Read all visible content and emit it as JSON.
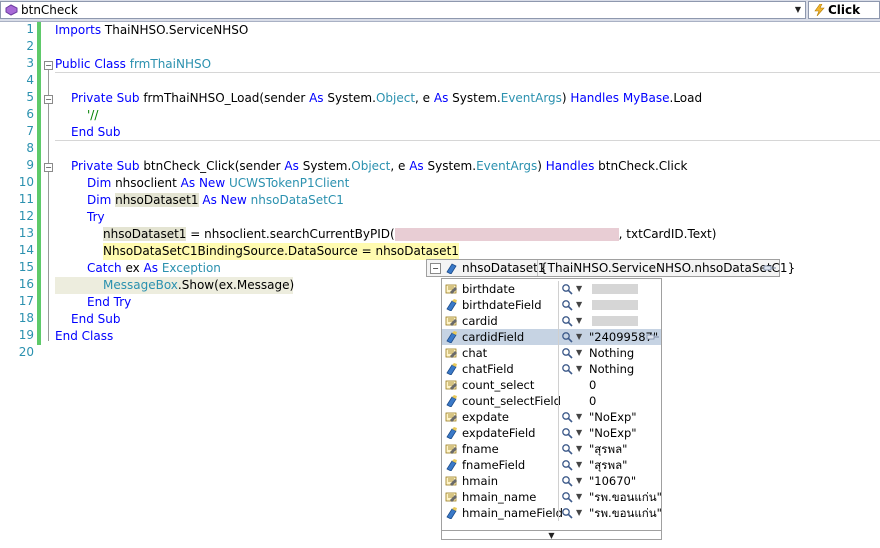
{
  "navbar": {
    "left_combo": "btnCheck",
    "right_combo": "Click"
  },
  "editor": {
    "line_numbers": [
      "1",
      "2",
      "3",
      "4",
      "5",
      "6",
      "7",
      "8",
      "9",
      "10",
      "11",
      "12",
      "13",
      "14",
      "15",
      "16",
      "17",
      "18",
      "19",
      "20"
    ],
    "lines": {
      "l1": {
        "kw1": "Imports",
        "t1": " ThaiNHSO.ServiceNHSO"
      },
      "l3": {
        "kw1": "Public",
        "kw2": " Class",
        "t1": " ",
        "ty1": "frmThaiNHSO"
      },
      "l5": {
        "kw1": "Private",
        "kw2": " Sub",
        "t1": " frmThaiNHSO_Load(sender ",
        "kw3": "As",
        "t2": " System.",
        "ty1": "Object",
        "t3": ", e ",
        "kw4": "As",
        "t4": " System.",
        "ty2": "EventArgs",
        "t5": ") ",
        "kw5": "Handles",
        "kw6": " MyBase",
        "t6": ".Load"
      },
      "l6": {
        "cm1": "'//"
      },
      "l7": {
        "kw1": "End",
        "kw2": " Sub"
      },
      "l9": {
        "kw1": "Private",
        "kw2": " Sub",
        "t1": " btnCheck_Click(sender ",
        "kw3": "As",
        "t2": " System.",
        "ty1": "Object",
        "t3": ", e ",
        "kw4": "As",
        "t4": " System.",
        "ty2": "EventArgs",
        "t5": ") ",
        "kw5": "Handles",
        "t6": " btnCheck.Click"
      },
      "l10": {
        "kw1": "Dim",
        "t1": " nhsoclient ",
        "kw2": "As",
        "kw3": " New",
        "t2": " ",
        "ty1": "UCWSTokenP1Client"
      },
      "l11": {
        "kw1": "Dim",
        "t1": " ",
        "ref": "nhsoDataset1",
        "t2": " ",
        "kw2": "As",
        "kw3": " New",
        "t3": " ",
        "ty1": "nhsoDataSetC1"
      },
      "l12": {
        "kw1": "Try"
      },
      "l13": {
        "t1": "nhsoDataset1",
        "t2": " = nhsoclient.searchCurrentByPID(",
        "t3": ", txtCardID.Text)"
      },
      "l14": {
        "t1": "NhsoDataSetC1BindingSource.DataSource = nhsoDataset1"
      },
      "l15": {
        "kw1": "Catch",
        "t1": " ex ",
        "kw2": "As",
        "t2": " ",
        "ty1": "Exception"
      },
      "l16": {
        "ty1": "MessageBox",
        "t1": ".Show(ex.Message)"
      },
      "l17": {
        "kw1": "End",
        "kw2": " Try"
      },
      "l18": {
        "kw1": "End",
        "kw2": " Sub"
      },
      "l19": {
        "kw1": "End",
        "kw2": " Class"
      }
    }
  },
  "datatip": {
    "header_name": "nhsoDataset1",
    "header_value": "{ThaiNHSO.ServiceNHSO.nhsoDataSetC1}",
    "rows": [
      {
        "name": "birthdate",
        "value": ""
      },
      {
        "name": "birthdateField",
        "value": ""
      },
      {
        "name": "cardid",
        "value": ""
      },
      {
        "name": "cardidField",
        "value": "\"24099587\""
      },
      {
        "name": "chat",
        "value": "Nothing"
      },
      {
        "name": "chatField",
        "value": "Nothing"
      },
      {
        "name": "count_select",
        "value": "0"
      },
      {
        "name": "count_selectField",
        "value": "0"
      },
      {
        "name": "expdate",
        "value": "\"NoExp\""
      },
      {
        "name": "expdateField",
        "value": "\"NoExp\""
      },
      {
        "name": "fname",
        "value": "\"สุรพล\""
      },
      {
        "name": "fnameField",
        "value": "\"สุรพล\""
      },
      {
        "name": "hmain",
        "value": "\"10670\""
      },
      {
        "name": "hmain_name",
        "value": "\"รพ.ขอนแก่น\""
      },
      {
        "name": "hmain_nameField",
        "value": "\"รพ.ขอนแก่น\""
      }
    ]
  },
  "icons": {
    "left_combo_icon": "method-icon",
    "right_combo_icon": "event-lightning-icon",
    "row_property_icon": "property-icon",
    "row_field_icon": "field-icon",
    "magnifier": "magnifier-icon",
    "pin": "pin-icon"
  },
  "colors": {
    "keyword": "#0000ff",
    "type": "#2b91af",
    "comment": "#008000",
    "line_number": "#2b91af",
    "change_bar": "#5ec96a",
    "current_statement": "#fffbb0",
    "selected_row": "#c6d3e3"
  }
}
